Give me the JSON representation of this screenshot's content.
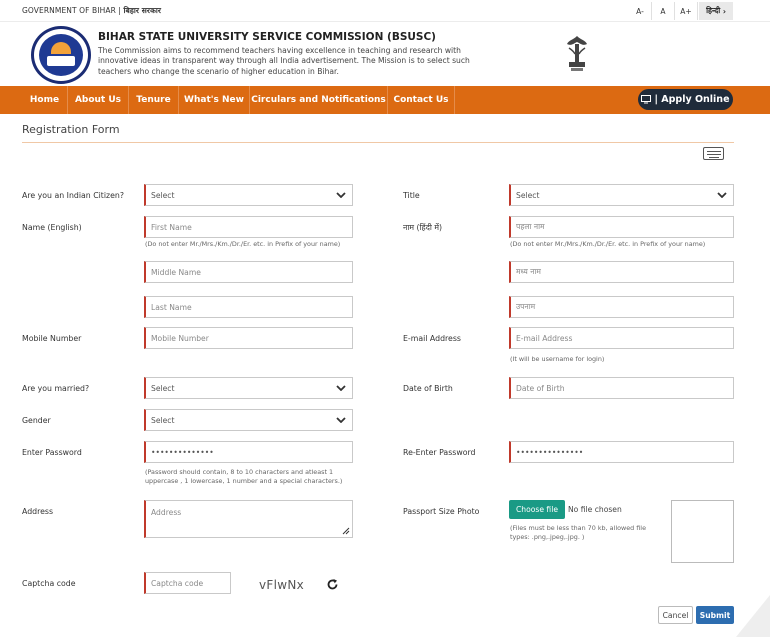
{
  "topbar": {
    "government": "GOVERNMENT OF BIHAR",
    "government_hindi": "बिहार सरकार",
    "font_small": "A-",
    "font_normal": "A",
    "font_large": "A+",
    "language_toggle": "हिन्दी"
  },
  "header": {
    "title": "BIHAR STATE UNIVERSITY SERVICE COMMISSION (BSUSC)",
    "tagline": "The Commission aims to recommend teachers having excellence in teaching and research with innovative ideas in transparent way through all India advertisement. The Mission is to select such teachers who change the scenario of higher education in Bihar."
  },
  "nav": {
    "items": [
      "Home",
      "About Us",
      "Tenure",
      "What's New",
      "Circulars and Notifications",
      "Contact Us"
    ],
    "apply_online": "| Apply Online"
  },
  "form": {
    "title": "Registration Form",
    "indian_citizen": {
      "label": "Are you an Indian Citizen?",
      "value": "Select"
    },
    "title_field": {
      "label": "Title",
      "value": "Select"
    },
    "name_english": {
      "label": "Name (English)",
      "first_placeholder": "First Name",
      "middle_placeholder": "Middle Name",
      "last_placeholder": "Last Name",
      "hint": "(Do not enter Mr./Mrs./Km./Dr./Er. etc. in Prefix of your name)"
    },
    "name_hindi": {
      "label": "नाम (हिंदी में)",
      "first_placeholder": "पहला नाम",
      "middle_placeholder": "मध्य नाम",
      "last_placeholder": "उपनाम",
      "hint": "(Do not enter Mr./Mrs./Km./Dr./Er. etc. in Prefix of your name)"
    },
    "mobile": {
      "label": "Mobile Number",
      "placeholder": "Mobile Number"
    },
    "email": {
      "label": "E-mail Address",
      "placeholder": "E-mail Address",
      "hint": "(It will be username for login)"
    },
    "married": {
      "label": "Are you married?",
      "value": "Select"
    },
    "dob": {
      "label": "Date of Birth",
      "placeholder": "Date of Birth"
    },
    "gender": {
      "label": "Gender",
      "value": "Select"
    },
    "password": {
      "label": "Enter Password",
      "value": "••••••••••••••",
      "hint_line1": "(Password should contain, 8 to 10 characters and atleast 1",
      "hint_line2": "uppercase , 1 lowercase, 1 number and a special characters.)"
    },
    "repassword": {
      "label": "Re-Enter Password",
      "value": "•••••••••••••••"
    },
    "address": {
      "label": "Address",
      "placeholder": "Address"
    },
    "photo": {
      "label": "Passport Size Photo",
      "button": "Choose file",
      "status": "No file chosen",
      "hint_line1": "(Files must be less than 70 kb, allowed file",
      "hint_line2": "types: .png,.jpeg,.jpg. )"
    },
    "captcha": {
      "label": "Captcha code",
      "placeholder": "Captcha code",
      "text": "vFlwNx"
    },
    "cancel": "Cancel",
    "submit": "Submit"
  },
  "colors": {
    "nav_bg": "#dc6a12",
    "apply_bg": "#1f2b3a",
    "required_border": "#c0392b",
    "file_button": "#1a9a85",
    "submit": "#2d6db0"
  }
}
